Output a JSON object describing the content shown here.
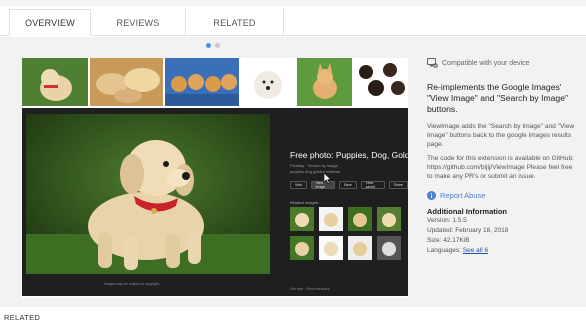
{
  "header": {
    "tabs": [
      {
        "label": "OVERVIEW",
        "active": true
      },
      {
        "label": "REVIEWS",
        "active": false
      },
      {
        "label": "RELATED",
        "active": false
      }
    ]
  },
  "carousel": {
    "page_count": 2,
    "current": 1
  },
  "screenshot": {
    "info_title": "Free photo: Puppies, Dog, Golden Retr...",
    "info_sub1": "Pixabay · Search by image",
    "info_sub2": "puppies dog golden retriever",
    "buttons": [
      "Visit",
      "View image",
      "Save",
      "View saved",
      "Share"
    ],
    "related_label": "Related images:",
    "caption": "Images may be subject to copyright.",
    "footer": "Get help · Send feedback"
  },
  "sidebar": {
    "compat_text": "Compatible with your device",
    "desc_title": "Re-implements the Google Images' \"View Image\" and \"Search by Image\" buttons.",
    "desc_p1": "ViewImage adds the \"Search by Image\" and \"View Image\" buttons back to the google images results page.",
    "desc_p2": "The code for this extension is available on GitHub: https://github.com/bijij/ViewImage Please feel free to make any PR's or submit an issue.",
    "report_abuse": "Report Abuse",
    "additional_info_title": "Additional Information",
    "version_label": "Version:",
    "version_value": "1.5.5",
    "updated_label": "Updated:",
    "updated_value": "February 18, 2018",
    "size_label": "Size:",
    "size_value": "42.17KiB",
    "languages_label": "Languages:",
    "languages_value": "See all 6"
  },
  "bottom_heading": "RELATED",
  "colors": {
    "accent": "#4a7fd1",
    "dot_active": "#4a8ef0",
    "dark_panel": "#1f1f1f"
  }
}
